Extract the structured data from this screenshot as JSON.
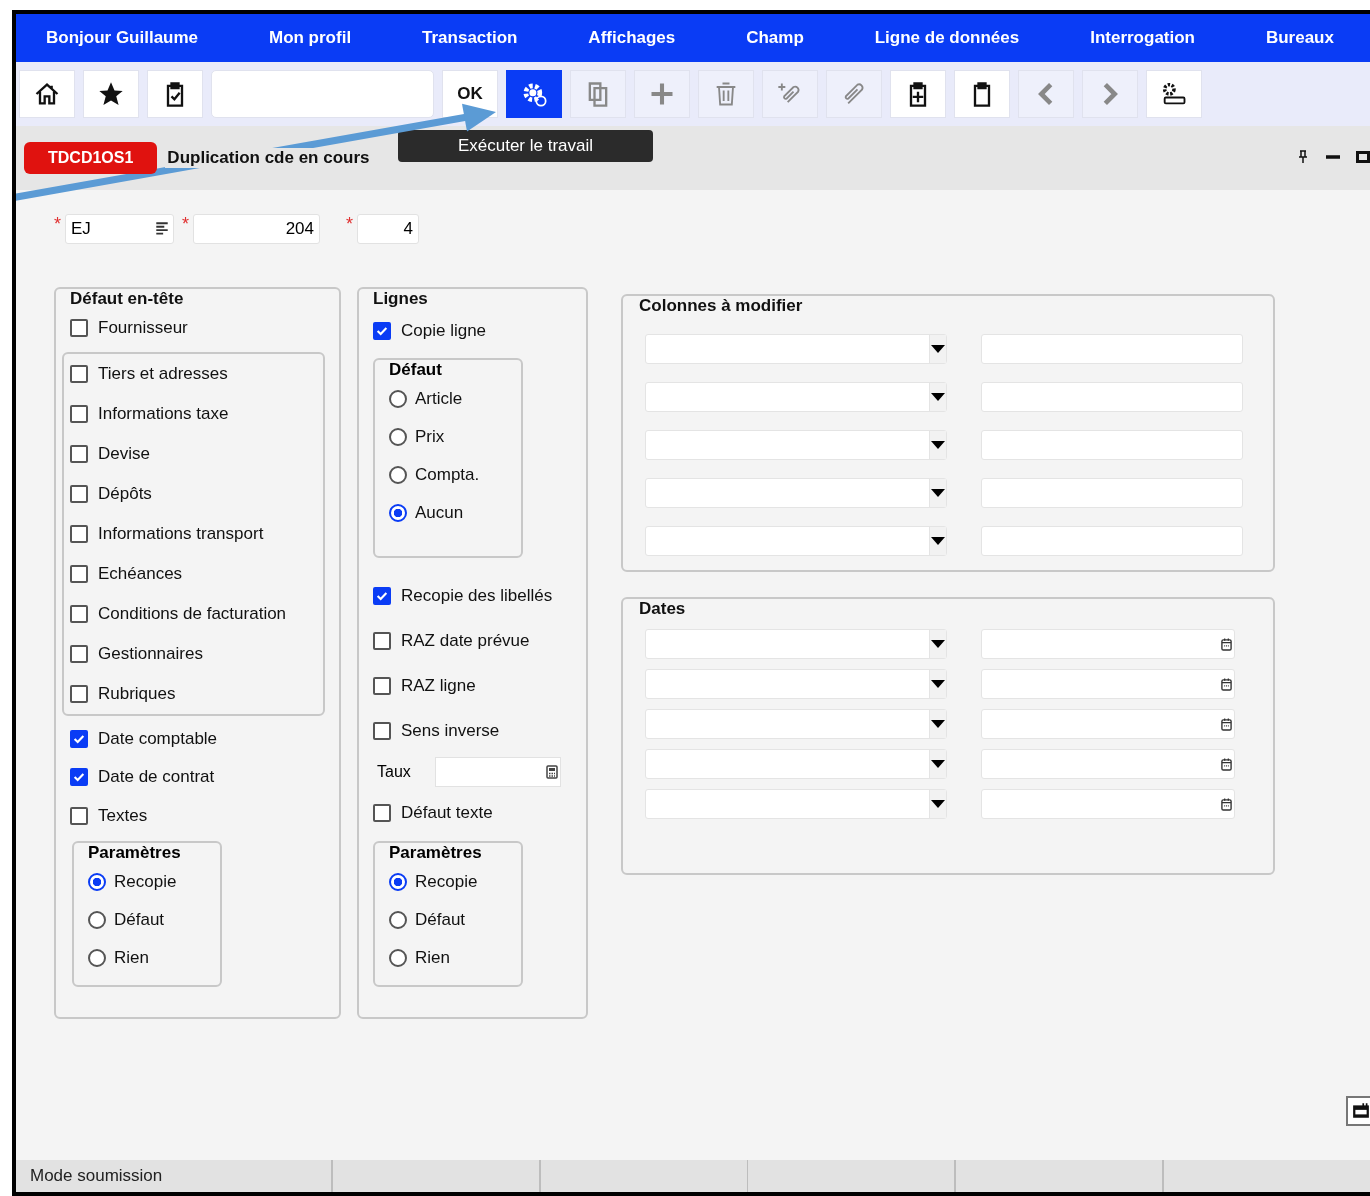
{
  "menu": [
    "Bonjour Guillaume",
    "Mon profil",
    "Transaction",
    "Affichages",
    "Champ",
    "Ligne de données",
    "Interrogation",
    "Bureaux"
  ],
  "toolbar": {
    "buttons": [
      {
        "kind": "icon",
        "disabled": false,
        "selected": false
      },
      {
        "kind": "icon",
        "disabled": false,
        "selected": false
      },
      {
        "kind": "icon",
        "disabled": false,
        "selected": false
      },
      {
        "kind": "field"
      },
      {
        "kind": "text",
        "label": "OK",
        "disabled": false,
        "selected": false
      },
      {
        "kind": "icon",
        "disabled": false,
        "selected": true
      },
      {
        "kind": "icon",
        "disabled": true,
        "selected": false
      },
      {
        "kind": "icon",
        "disabled": true,
        "selected": false
      },
      {
        "kind": "icon",
        "disabled": true,
        "selected": false
      },
      {
        "kind": "icon",
        "disabled": true,
        "selected": false
      },
      {
        "kind": "icon",
        "disabled": true,
        "selected": false
      },
      {
        "kind": "icon",
        "disabled": false,
        "selected": false
      },
      {
        "kind": "icon",
        "disabled": false,
        "selected": false
      },
      {
        "kind": "icon",
        "disabled": true,
        "selected": false
      },
      {
        "kind": "icon",
        "disabled": true,
        "selected": false
      },
      {
        "kind": "icon",
        "disabled": false,
        "selected": false
      }
    ],
    "tooltip": "Exécuter le travail"
  },
  "header": {
    "code": "TDCD1OS1",
    "title": "Duplication cde en cours"
  },
  "keys": [
    {
      "mark": "*",
      "value": "EJ",
      "list": true
    },
    {
      "mark": "*",
      "value": "204",
      "list": false
    },
    {
      "mark": "*",
      "value": "4",
      "list": false
    }
  ],
  "groups": [
    {
      "title": "Défaut en-tête",
      "items": [
        {
          "kind": "checkbox",
          "label": "Fournisseur",
          "checked": false
        },
        {
          "kind": "box",
          "items": [
            {
              "kind": "checkbox",
              "label": "Tiers et adresses",
              "checked": false
            },
            {
              "kind": "checkbox",
              "label": "Informations taxe",
              "checked": false
            },
            {
              "kind": "checkbox",
              "label": "Devise",
              "checked": false
            },
            {
              "kind": "checkbox",
              "label": "Dépôts",
              "checked": false
            },
            {
              "kind": "checkbox",
              "label": "Informations transport",
              "checked": false
            },
            {
              "kind": "checkbox",
              "label": "Echéances",
              "checked": false
            },
            {
              "kind": "checkbox",
              "label": "Conditions de facturation",
              "checked": false
            },
            {
              "kind": "checkbox",
              "label": "Gestionnaires",
              "checked": false
            },
            {
              "kind": "checkbox",
              "label": "Rubriques",
              "checked": false
            }
          ]
        },
        {
          "kind": "checkbox",
          "label": "Date comptable",
          "checked": true
        },
        {
          "kind": "checkbox",
          "label": "Date de contrat",
          "checked": true
        },
        {
          "kind": "checkbox",
          "label": "Textes",
          "checked": false
        },
        {
          "kind": "radiogroup",
          "title": "Paramètres",
          "options": [
            {
              "label": "Recopie",
              "selected": true
            },
            {
              "label": "Défaut",
              "selected": false
            },
            {
              "label": "Rien",
              "selected": false
            }
          ]
        }
      ]
    },
    {
      "title": "Lignes",
      "items": [
        {
          "kind": "checkbox",
          "label": "Copie ligne",
          "checked": true
        },
        {
          "kind": "radiogroup",
          "title": "Défaut",
          "options": [
            {
              "label": "Article",
              "selected": false
            },
            {
              "label": "Prix",
              "selected": false
            },
            {
              "label": "Compta.",
              "selected": false
            },
            {
              "label": "Aucun",
              "selected": true
            }
          ]
        },
        {
          "kind": "checkbox",
          "label": "Recopie des libellés",
          "checked": true
        },
        {
          "kind": "checkbox",
          "label": "RAZ date prévue",
          "checked": false
        },
        {
          "kind": "checkbox",
          "label": "RAZ ligne",
          "checked": false
        },
        {
          "kind": "checkbox",
          "label": "Sens inverse",
          "checked": false
        },
        {
          "kind": "field",
          "label": "Taux"
        },
        {
          "kind": "checkbox",
          "label": "Défaut texte",
          "checked": false
        },
        {
          "kind": "radiogroup",
          "title": "Paramètres",
          "options": [
            {
              "label": "Recopie",
              "selected": true
            },
            {
              "label": "Défaut",
              "selected": false
            },
            {
              "label": "Rien",
              "selected": false
            }
          ]
        }
      ]
    }
  ],
  "panels": [
    {
      "title": "Colonnes à modifier",
      "rows": [
        {
          "kind": "text"
        },
        {
          "kind": "text"
        },
        {
          "kind": "text"
        },
        {
          "kind": "text"
        },
        {
          "kind": "text"
        }
      ]
    },
    {
      "title": "Dates",
      "rows": [
        {
          "kind": "date"
        },
        {
          "kind": "date"
        },
        {
          "kind": "date"
        },
        {
          "kind": "date"
        },
        {
          "kind": "date"
        }
      ]
    }
  ],
  "status_bar": [
    "Mode soumission"
  ]
}
